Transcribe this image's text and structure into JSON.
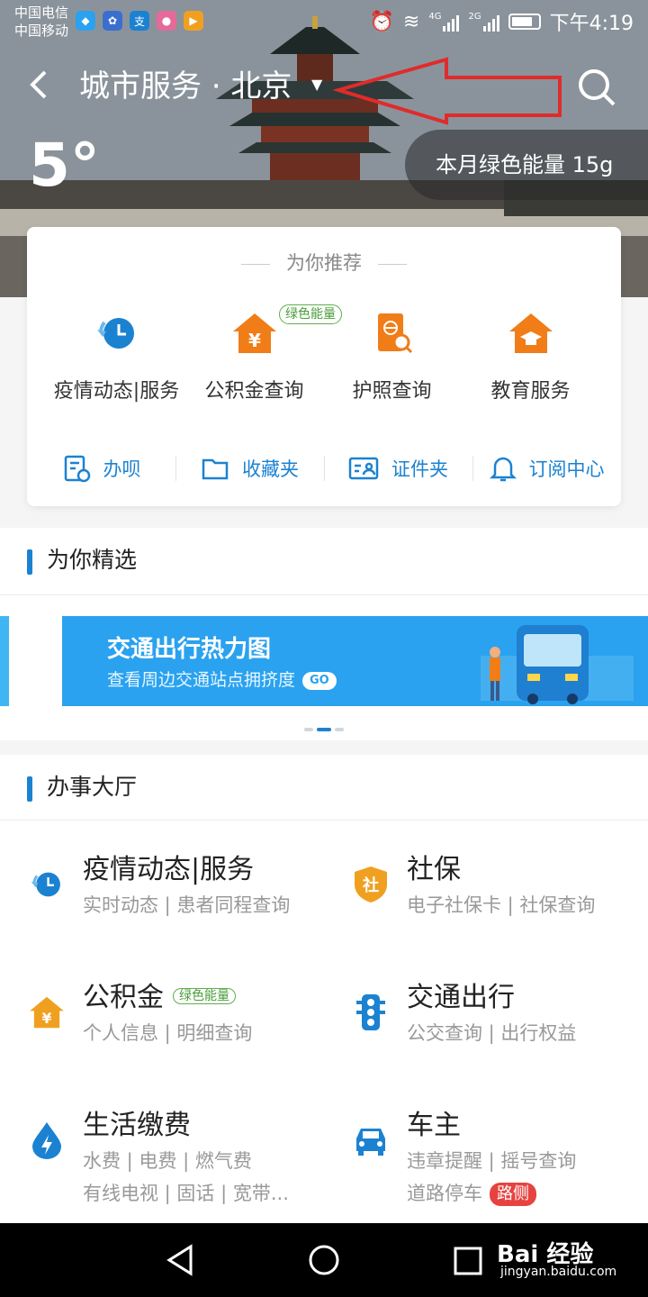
{
  "status_bar": {
    "carrier_1": "中国电信",
    "carrier_2": "中国移动",
    "network_1": "4G",
    "network_2": "2G",
    "time": "下午4:19"
  },
  "header": {
    "title": "城市服务 · 北京",
    "temperature": "5°",
    "green_energy": "本月绿色能量 15g"
  },
  "recommend": {
    "title": "为你推荐",
    "items": [
      {
        "label": "疫情动态|服务",
        "icon": "clock-refresh-icon"
      },
      {
        "label": "公积金查询",
        "icon": "yuan-house-icon",
        "badge": "绿色能量"
      },
      {
        "label": "护照查询",
        "icon": "passport-search-icon"
      },
      {
        "label": "教育服务",
        "icon": "graduation-house-icon"
      }
    ],
    "quick": [
      {
        "label": "办呗",
        "icon": "document-clock-icon"
      },
      {
        "label": "收藏夹",
        "icon": "folder-icon"
      },
      {
        "label": "证件夹",
        "icon": "id-card-icon"
      },
      {
        "label": "订阅中心",
        "icon": "bell-icon"
      }
    ]
  },
  "featured": {
    "title": "为你精选",
    "banner_title": "交通出行热力图",
    "banner_sub": "查看周边交通站点拥挤度",
    "banner_go": "GO"
  },
  "hall": {
    "title": "办事大厅",
    "services": [
      {
        "name": "疫情动态|服务",
        "desc": "实时动态 | 患者同程查询",
        "icon": "clock-refresh-icon"
      },
      {
        "name": "社保",
        "desc": "电子社保卡 | 社保查询",
        "icon": "shield-icon"
      },
      {
        "name": "公积金",
        "badge": "绿色能量",
        "desc": "个人信息 | 明细查询",
        "icon": "yuan-house-icon"
      },
      {
        "name": "交通出行",
        "desc": "公交查询 | 出行权益",
        "icon": "traffic-light-icon"
      },
      {
        "name": "生活缴费",
        "desc": "水费 | 电费 | 燃气费",
        "desc2": "有线电视 | 固话 | 宽带...",
        "icon": "water-drop-icon"
      },
      {
        "name": "车主",
        "desc": "违章提醒 | 摇号查询",
        "desc2": "道路停车",
        "badge_red": "路侧",
        "icon": "car-icon"
      }
    ]
  },
  "watermark": {
    "brand": "Bai 经验",
    "url": "jingyan.baidu.com"
  },
  "colors": {
    "accent": "#1b82d1",
    "orange": "#f07d18",
    "green_badge": "#5bb04a",
    "red_badge": "#e64340"
  }
}
